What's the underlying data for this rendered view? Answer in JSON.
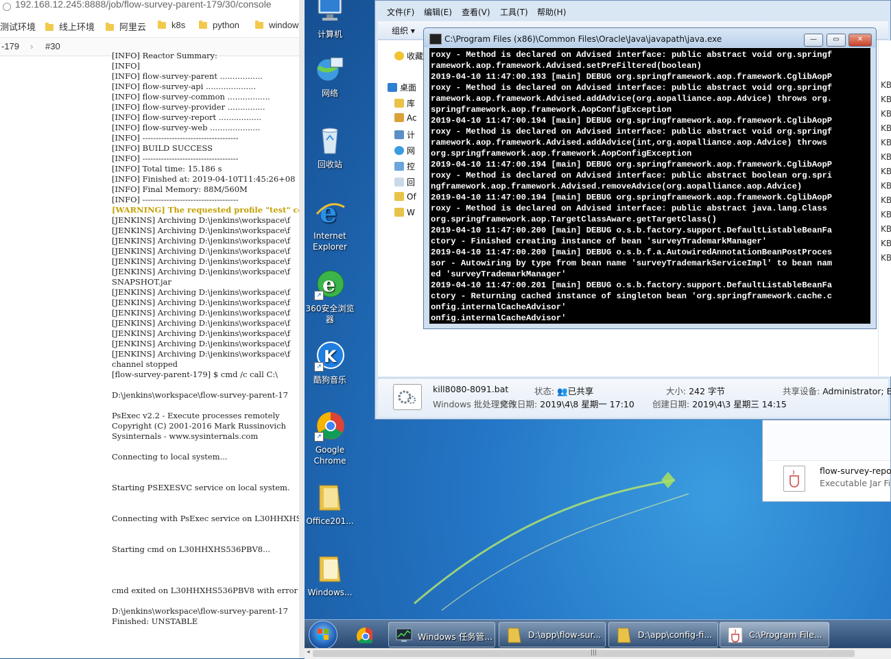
{
  "browser": {
    "address": "192.168.12.245:8888/job/flow-survey-parent-179/30/console",
    "bookmarks": [
      "测试环境",
      "线上环境",
      "阿里云",
      "k8s",
      "python",
      "window"
    ],
    "breadcrumbs": [
      "-179",
      "#30"
    ],
    "console_lines": [
      "[INFO] Reactor Summary:",
      "[INFO]",
      "[INFO] flow-survey-parent .................",
      "[INFO] flow-survey-api ....................",
      "[INFO] flow-survey-common .................",
      "[INFO] flow-survey-provider ...............",
      "[INFO] flow-survey-report .................",
      "[INFO] flow-survey-web ....................",
      "[INFO] ------------------------------------",
      "[INFO] BUILD SUCCESS",
      "[INFO] ------------------------------------",
      "[INFO] Total time: 15.186 s",
      "[INFO] Finished at: 2019-04-10T11:45:26+08",
      "[INFO] Final Memory: 88M/560M",
      "[INFO] ------------------------------------",
      "[WARNING] The requested profile \"test\" co",
      "[JENKINS] Archiving D:\\jenkins\\workspace\\f",
      "[JENKINS] Archiving D:\\jenkins\\workspace\\f",
      "[JENKINS] Archiving D:\\jenkins\\workspace\\f",
      "[JENKINS] Archiving D:\\jenkins\\workspace\\f",
      "[JENKINS] Archiving D:\\jenkins\\workspace\\f",
      "[JENKINS] Archiving D:\\jenkins\\workspace\\f",
      "SNAPSHOT.jar",
      "[JENKINS] Archiving D:\\jenkins\\workspace\\f",
      "[JENKINS] Archiving D:\\jenkins\\workspace\\f",
      "[JENKINS] Archiving D:\\jenkins\\workspace\\f",
      "[JENKINS] Archiving D:\\jenkins\\workspace\\f",
      "[JENKINS] Archiving D:\\jenkins\\workspace\\f",
      "[JENKINS] Archiving D:\\jenkins\\workspace\\f",
      "[JENKINS] Archiving D:\\jenkins\\workspace\\f",
      "channel stopped",
      "[flow-survey-parent-179] $ cmd /c call C:\\",
      "",
      "D:\\jenkins\\workspace\\flow-survey-parent-17",
      "",
      "PsExec v2.2 - Execute processes remotely",
      "Copyright (C) 2001-2016 Mark Russinovich",
      "Sysinternals - www.sysinternals.com",
      "",
      "Connecting to local system...",
      "",
      "",
      "Starting PSEXESVC service on local system.",
      "",
      "",
      "Connecting with PsExec service on L30HHXHS",
      "",
      "",
      "Starting cmd on L30HHXHS536PBV8...",
      "",
      "",
      "",
      "cmd exited on L30HHXHS536PBV8 with error c",
      "",
      "D:\\jenkins\\workspace\\flow-survey-parent-17",
      "Finished: UNSTABLE"
    ]
  },
  "desktop": {
    "icons": [
      {
        "label": "计算机",
        "icon": "computer-icon"
      },
      {
        "label": "网络",
        "icon": "network-icon"
      },
      {
        "label": "回收站",
        "icon": "recycle-bin-icon"
      },
      {
        "label": "Internet Explorer",
        "icon": "internet-explorer-icon"
      },
      {
        "label": "360安全浏览器",
        "icon": "360-browser-icon"
      },
      {
        "label": "酷狗音乐",
        "icon": "kugou-icon"
      },
      {
        "label": "Google Chrome",
        "icon": "chrome-icon"
      },
      {
        "label": "Office201...",
        "icon": "folder-icon"
      },
      {
        "label": "Windows...",
        "icon": "folder-icon"
      }
    ]
  },
  "explorer": {
    "menu": [
      "文件(F)",
      "编辑(E)",
      "查看(V)",
      "工具(T)",
      "帮助(H)"
    ],
    "toolbar_organize": "组织 ▾",
    "nav_items": [
      "收藏",
      "桌面",
      "库",
      "Ac",
      "计",
      "网",
      "控",
      "回",
      "Of",
      "W"
    ],
    "size_column": [
      "KB",
      "KB",
      "KB",
      "KB",
      "KB",
      "KB",
      "KB",
      "KB",
      "KB",
      "KB",
      "KB",
      "KB",
      "KB"
    ],
    "status": {
      "file_name": "kill8080-8091.bat",
      "file_type": "Windows 批处理文件",
      "state_label": "状态:",
      "state_value": "已共享",
      "size_label": "大小:",
      "size_value": "242 字节",
      "shared_label": "共享设备:",
      "shared_value": "Administrator; Ev",
      "modified_label": "修改日期:",
      "modified_value": "2019\\4\\8 星期一 17:10",
      "created_label": "创建日期:",
      "created_value": "2019\\4\\3 星期三 14:15"
    }
  },
  "filelist2": {
    "name": "flow-survey-repo",
    "type": "Executable Jar File"
  },
  "java_console": {
    "title": "C:\\Program Files (x86)\\Common Files\\Oracle\\Java\\javapath\\java.exe",
    "lines": [
      "roxy - Method is declared on Advised interface: public abstract void org.springf",
      "ramework.aop.framework.Advised.setPreFiltered(boolean)",
      "2019-04-10 11:47:00.193 [main] DEBUG org.springframework.aop.framework.CglibAopP",
      "roxy - Method is declared on Advised interface: public abstract void org.springf",
      "ramework.aop.framework.Advised.addAdvice(org.aopalliance.aop.Advice) throws org.",
      "springframework.aop.framework.AopConfigException",
      "2019-04-10 11:47:00.194 [main] DEBUG org.springframework.aop.framework.CglibAopP",
      "roxy - Method is declared on Advised interface: public abstract void org.springf",
      "ramework.aop.framework.Advised.addAdvice(int,org.aopalliance.aop.Advice) throws",
      "org.springframework.aop.framework.AopConfigException",
      "2019-04-10 11:47:00.194 [main] DEBUG org.springframework.aop.framework.CglibAopP",
      "roxy - Method is declared on Advised interface: public abstract boolean org.spri",
      "ngframework.aop.framework.Advised.removeAdvice(org.aopalliance.aop.Advice)",
      "2019-04-10 11:47:00.194 [main] DEBUG org.springframework.aop.framework.CglibAopP",
      "roxy - Method is declared on Advised interface: public abstract java.lang.Class",
      "org.springframework.aop.TargetClassAware.getTargetClass()",
      "2019-04-10 11:47:00.200 [main] DEBUG o.s.b.factory.support.DefaultListableBeanFa",
      "ctory - Finished creating instance of bean 'surveyTrademarkManager'",
      "2019-04-10 11:47:00.200 [main] DEBUG o.s.b.f.a.AutowiredAnnotationBeanPostProces",
      "sor - Autowiring by type from bean name 'surveyTrademarkServiceImpl' to bean nam",
      "ed 'surveyTrademarkManager'",
      "2019-04-10 11:47:00.201 [main] DEBUG o.s.b.factory.support.DefaultListableBeanFa",
      "ctory - Returning cached instance of singleton bean 'org.springframework.cache.c",
      "onfig.internalCacheAdvisor'",
      "onfig.internalCacheAdvisor'"
    ]
  },
  "taskbar": {
    "items": [
      {
        "label": "",
        "icon": "chrome-icon"
      },
      {
        "label": "Windows 任务管...",
        "icon": "task-manager-icon"
      },
      {
        "label": "D:\\app\\flow-sur...",
        "icon": "folder-icon"
      },
      {
        "label": "D:\\app\\config-fi...",
        "icon": "folder-icon"
      },
      {
        "label": "C:\\Program File...",
        "icon": "java-icon"
      }
    ]
  },
  "colors": {
    "warning": "#c4a000",
    "desktop": "#2476c6",
    "console_bg": "#000000",
    "console_fg": "#ffffff"
  }
}
